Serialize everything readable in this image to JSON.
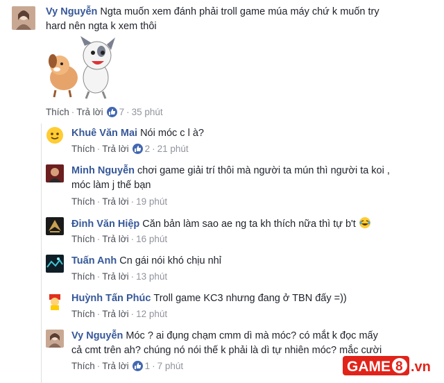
{
  "comments": [
    {
      "name": "Vy Nguyễn",
      "line1": "Ngta muốn xem đánh phải troll game múa máy chứ k muốn try",
      "line2": "hard nên ngta k xem thôi",
      "like_label": "Thích",
      "reply_label": "Trả lời",
      "reactions": "7",
      "time": "35 phút"
    },
    {
      "name": "Khuê Văn Mai",
      "line1": "Nói móc c l à?",
      "like_label": "Thích",
      "reply_label": "Trả lời",
      "reactions": "2",
      "time": "21 phút"
    },
    {
      "name": "Minh Nguyễn",
      "line1": "chơi game giải trí thôi mà người ta mún thì người ta koi ,",
      "line2": "móc làm j thế bạn",
      "like_label": "Thích",
      "reply_label": "Trả lời",
      "time": "19 phút"
    },
    {
      "name": "Đinh Văn Hiệp",
      "line1": "Căn bản làm sao ae ng ta kh thích nữa thì tự b't",
      "like_label": "Thích",
      "reply_label": "Trả lời",
      "time": "16 phút"
    },
    {
      "name": "Tuấn Anh",
      "line1": "Cn gái nói khó chịu nhỉ",
      "like_label": "Thích",
      "reply_label": "Trả lời",
      "time": "13 phút"
    },
    {
      "name": "Huỳnh Tấn Phúc",
      "line1": "Troll game KC3 nhưng đang ở TBN đấy =))",
      "like_label": "Thích",
      "reply_label": "Trả lời",
      "time": "12 phút"
    },
    {
      "name": "Vy Nguyễn",
      "line1": "Móc ? ai đụng chạm cmm dì mà móc? có mắt k đọc mấy",
      "line2": "cả cmt trên ah? chúng nó nói thế k phải là dì tự nhiên móc? mắc cười",
      "like_label": "Thích",
      "reply_label": "Trả lời",
      "reactions": "1",
      "time": "7 phút"
    }
  ],
  "watermark": {
    "brand": "GAME",
    "digit": "8",
    "suffix": ".vn"
  },
  "colors": {
    "name": "#365899",
    "like": "#4267b2",
    "meta": "#90949c",
    "watermark_red": "#e2231a"
  }
}
